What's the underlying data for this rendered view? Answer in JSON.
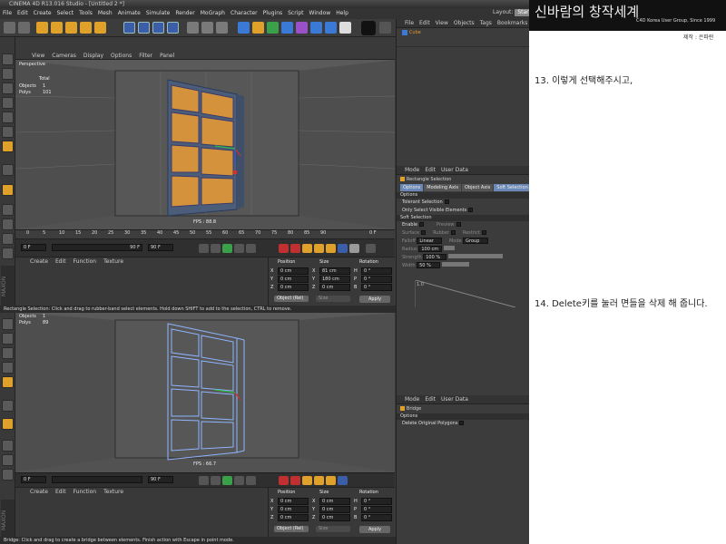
{
  "app": {
    "title": "CINEMA 4D R13.016 Studio - [Untitled 2 *]",
    "menu": [
      "File",
      "Edit",
      "Create",
      "Select",
      "Tools",
      "Mesh",
      "Animate",
      "Simulate",
      "Render",
      "MoGraph",
      "Character",
      "Plugins",
      "Script",
      "Window",
      "Help"
    ],
    "layout_label": "Layout:",
    "layout_value": "Start"
  },
  "viewport_top": {
    "menu": [
      "View",
      "Cameras",
      "Display",
      "Options",
      "Filter",
      "Panel"
    ],
    "label": "Perspective",
    "hud_total": "Total",
    "hud_objects_label": "Objects",
    "hud_objects_value": "1",
    "hud_polys_label": "Polys",
    "hud_polys_value": "101",
    "fps": "FPS : 88.8"
  },
  "viewport_bottom": {
    "hud_objects_label": "Objects",
    "hud_objects_value": "1",
    "hud_polys_label": "Polys",
    "hud_polys_value": "89",
    "fps": "FPS : 66.7"
  },
  "timeline": {
    "ticks": [
      "0",
      "5",
      "10",
      "15",
      "20",
      "25",
      "30",
      "35",
      "40",
      "45",
      "50",
      "55",
      "60",
      "65",
      "70",
      "75",
      "80",
      "85",
      "90"
    ],
    "end_frame": "0 F",
    "start_field": "0 F",
    "current_field": "0 F",
    "range_end": "90 F",
    "range_max": "90 F"
  },
  "material_menu": [
    "Create",
    "Edit",
    "Function",
    "Texture"
  ],
  "coords": {
    "headers": [
      "Position",
      "Size",
      "Rotation"
    ],
    "pos": [
      [
        "X",
        "0 cm"
      ],
      [
        "Y",
        "0 cm"
      ],
      [
        "Z",
        "0 cm"
      ]
    ],
    "size_top": [
      [
        "X",
        "81 cm"
      ],
      [
        "Y",
        "180 cm"
      ],
      [
        "Z",
        "0 cm"
      ]
    ],
    "size_bottom": [
      [
        "X",
        "0 cm"
      ],
      [
        "Y",
        "0 cm"
      ],
      [
        "Z",
        "0 cm"
      ]
    ],
    "rot": [
      [
        "H",
        "0 °"
      ],
      [
        "P",
        "0 °"
      ],
      [
        "B",
        "0 °"
      ]
    ],
    "object_mode": "Object (Rel)",
    "size_mode": "Size",
    "apply": "Apply"
  },
  "status_top": "Rectangle Selection: Click and drag to rubber-band select elements. Hold down SHIFT to add to the selection, CTRL to remove.",
  "status_bottom": "Bridge: Click and drag to create a bridge between elements. Finish action with Escape in point mode.",
  "object_manager": {
    "menu": [
      "File",
      "Edit",
      "View",
      "Objects",
      "Tags",
      "Bookmarks"
    ],
    "object_name": "Cube"
  },
  "attr_top": {
    "menu": [
      "Mode",
      "Edit",
      "User Data"
    ],
    "tool_name": "Rectangle Selection",
    "tabs": [
      "Options",
      "Modeling Axis",
      "Object Axis",
      "Soft Selection"
    ],
    "options_header": "Options",
    "tolerant": "Tolerant Selection",
    "only_visible": "Only Select Visible Elements",
    "soft_header": "Soft Selection",
    "enable": "Enable",
    "preview": "Preview",
    "surface": "Surface",
    "rubber": "Rubber",
    "restrict": "Restrict",
    "falloff": "Falloff",
    "falloff_val": "Linear",
    "mode": "Mode",
    "mode_val": "Group",
    "radius": "Radius",
    "radius_val": "100 cm",
    "strength": "Strength",
    "strength_val": "100 %",
    "width": "Width",
    "width_val": "50 %",
    "graph_label": "1.0"
  },
  "attr_bottom": {
    "menu": [
      "Mode",
      "Edit",
      "User Data"
    ],
    "tool_name": "Bridge",
    "options_header": "Options",
    "delete_orig": "Delete Original Polygons"
  },
  "tutorial": {
    "logo_text": "신바람의 창작세계",
    "logo_sub": "C4D Korea User Group, Since 1999",
    "credit": "제작 : 은파란",
    "step13": "13. 이렇게 선택해주시고,",
    "step14": "14. Delete키를 눌러 면들을 삭제 해 줍니다."
  },
  "colors": {
    "accent_orange": "#d4923c",
    "selection_blue": "#6a87b5",
    "viewport_grey": "#5a5a5a",
    "wire_blue": "#8fb4ff"
  }
}
